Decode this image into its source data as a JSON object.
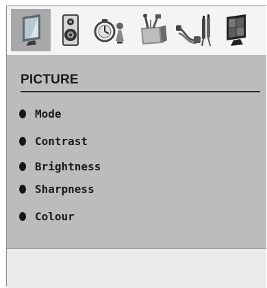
{
  "header": {
    "tabs": [
      {
        "icon": "picture-icon",
        "active": true
      },
      {
        "icon": "sound-icon",
        "active": false
      },
      {
        "icon": "settings-icon",
        "active": false
      },
      {
        "icon": "install-icon",
        "active": false
      },
      {
        "icon": "source-icon",
        "active": false
      },
      {
        "icon": "pc-icon",
        "active": false
      }
    ]
  },
  "menu": {
    "title": "PICTURE",
    "items": [
      {
        "label": "Mode"
      },
      {
        "label": "Contrast"
      },
      {
        "label": "Brightness"
      },
      {
        "label": "Sharpness"
      },
      {
        "label": "Colour"
      }
    ]
  },
  "colors": {
    "panel_bg": "#bcbcbc",
    "active_tab": "#a8a8a8",
    "text": "#1a1a1a"
  }
}
